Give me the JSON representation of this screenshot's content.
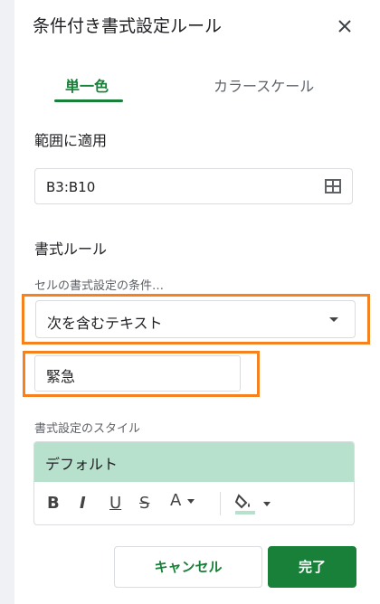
{
  "header": {
    "title": "条件付き書式設定ルール"
  },
  "tabs": [
    {
      "label": "単一色",
      "active": true
    },
    {
      "label": "カラースケール",
      "active": false
    }
  ],
  "range": {
    "heading": "範囲に適用",
    "value": "B3:B10"
  },
  "rules": {
    "heading": "書式ルール",
    "condition_label": "セルの書式設定の条件…",
    "condition_value": "次を含むテキスト",
    "value_input": "緊急"
  },
  "style": {
    "label": "書式設定のスタイル",
    "preview_text": "デフォルト",
    "preview_color": "#b7e1cd",
    "toolbar": {
      "bold": "B",
      "italic": "I",
      "underline": "U",
      "strikethrough": "S",
      "text_color": "A"
    }
  },
  "buttons": {
    "cancel": "キャンセル",
    "done": "完了"
  },
  "colors": {
    "accent": "#188038",
    "highlight": "#f5821f"
  }
}
